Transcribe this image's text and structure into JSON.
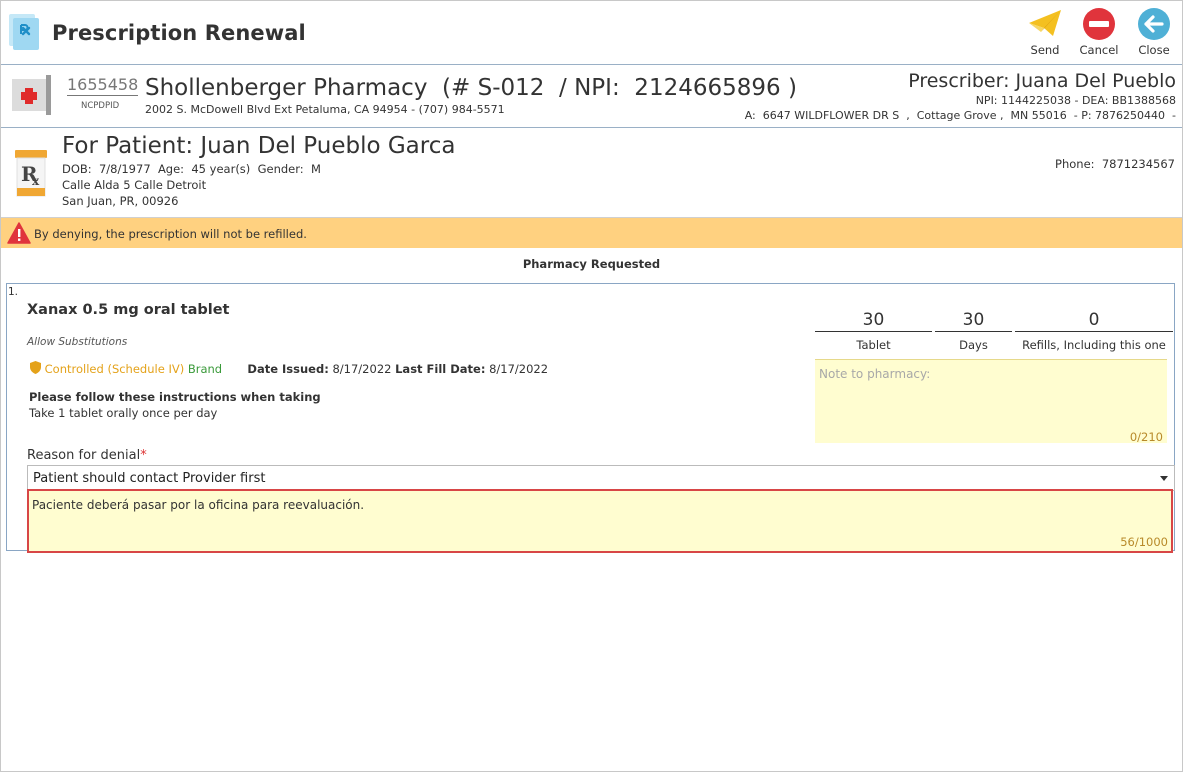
{
  "window": {
    "title": "Prescription Renewal"
  },
  "toolbar": {
    "send_label": "Send",
    "cancel_label": "Cancel",
    "close_label": "Close"
  },
  "pharmacy": {
    "ncpdp_id": "1655458",
    "ncpdp_label": "NCPDPID",
    "name_line": "Shollenberger Pharmacy  (# S-012  / NPI:  2124665896 )",
    "address": "2002 S. McDowell Blvd Ext Petaluma, CA 94954 - (707) 984-5571"
  },
  "prescriber": {
    "title": "Prescriber: Juana Del Pueblo",
    "ids": "NPI: 1144225038 - DEA: BB1388568",
    "address": "A:  6647 WILDFLOWER DR S  ,  Cottage Grove ,  MN 55016  - P: 7876250440  -"
  },
  "patient": {
    "title": "For Patient:  Juan Del Pueblo Garca",
    "demographics": "DOB:  7/8/1977  Age:  45 year(s)  Gender:  M",
    "address1": "Calle Alda 5 Calle Detroit",
    "address2": "San Juan, PR, 00926",
    "phone": "Phone:  7871234567"
  },
  "warning": {
    "text": "By denying, the prescription will not be refilled."
  },
  "section": {
    "title": "Pharmacy Requested"
  },
  "prescription": {
    "index": "1.",
    "drug": "Xanax 0.5 mg oral tablet",
    "substitution": "Allow Substitutions",
    "schedule": "Controlled (Schedule IV)",
    "brand": "Brand",
    "issued_label": "Date Issued:",
    "issued_value": "8/17/2022",
    "last_fill_label": "Last Fill Date:",
    "last_fill_value": "8/17/2022",
    "instructions_heading": "Please follow these instructions when taking",
    "instructions": "Take 1 tablet orally once per day",
    "quantity": {
      "value": "30",
      "unit": "Tablet"
    },
    "days": {
      "value": "30",
      "unit": "Days"
    },
    "refills": {
      "value": "0",
      "unit": "Refills, Including this one"
    },
    "note_placeholder": "Note to pharmacy:",
    "note_count": "0/210"
  },
  "denial": {
    "label": "Reason for denial",
    "required_mark": "*",
    "selected_reason": "Patient should contact Provider first",
    "comment": "Paciente deberá pasar por la oficina para reevaluación.",
    "comment_count": "56/1000"
  },
  "colors": {
    "warning_bg": "#ffd180",
    "note_bg": "#fffdd0",
    "highlight_border": "#d84646",
    "schedule_text": "#e4a21a",
    "brand_text": "#3a9a3a"
  },
  "icons": {
    "app": "prescription-pad-icon",
    "send": "paper-plane-icon",
    "cancel": "no-entry-icon",
    "close": "back-arrow-icon",
    "pharmacy": "pharmacy-cross-icon",
    "patient": "pill-bottle-rx-icon",
    "warning": "warning-triangle-icon",
    "controlled": "controlled-shield-icon"
  }
}
